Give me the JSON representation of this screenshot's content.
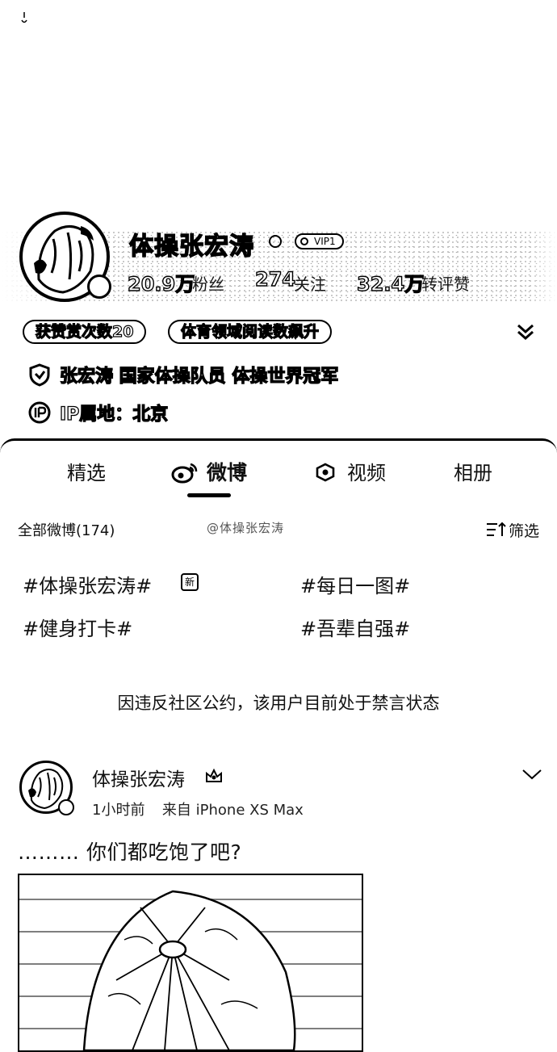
{
  "profile": {
    "name": "体操张宏涛",
    "vip_label": "VIP1",
    "stats": [
      {
        "value": "20.9万",
        "label": "粉丝"
      },
      {
        "value": "274",
        "label": "关注"
      },
      {
        "value": "32.4万",
        "label": "转评赞"
      }
    ],
    "tags": [
      "获赞赏次数20",
      "体育领域阅读数飙升"
    ],
    "verified": "张宏涛 国家体操队员 体操世界冠军",
    "ip": "IP属地：北京"
  },
  "tabs": [
    {
      "label": "精选"
    },
    {
      "label": "微博"
    },
    {
      "label": "视频"
    },
    {
      "label": "相册"
    }
  ],
  "filter": {
    "all_label": "全部微博(174)",
    "watermark": "@体操张宏涛",
    "filter_label": "筛选"
  },
  "topics": [
    "#体操张宏涛#",
    "#每日一图#",
    "#健身打卡#",
    "#吾辈自强#"
  ],
  "hot_badge": "新",
  "ban_notice": "因违反社区公约，该用户目前处于禁言状态",
  "post": {
    "author": "体操张宏涛",
    "time": "1小时前",
    "source": "来自 iPhone XS Max",
    "text": "……… 你们都吃饱了吧?"
  },
  "icons": {
    "gender": "gender-icon",
    "vip": "vip-icon",
    "expand": "chevron-down-double-icon",
    "verified": "shield-icon",
    "ip": "ip-icon",
    "weibo": "weibo-icon",
    "video": "video-icon",
    "filter": "filter-icon",
    "crown": "crown-icon",
    "more": "chevron-down-icon"
  }
}
